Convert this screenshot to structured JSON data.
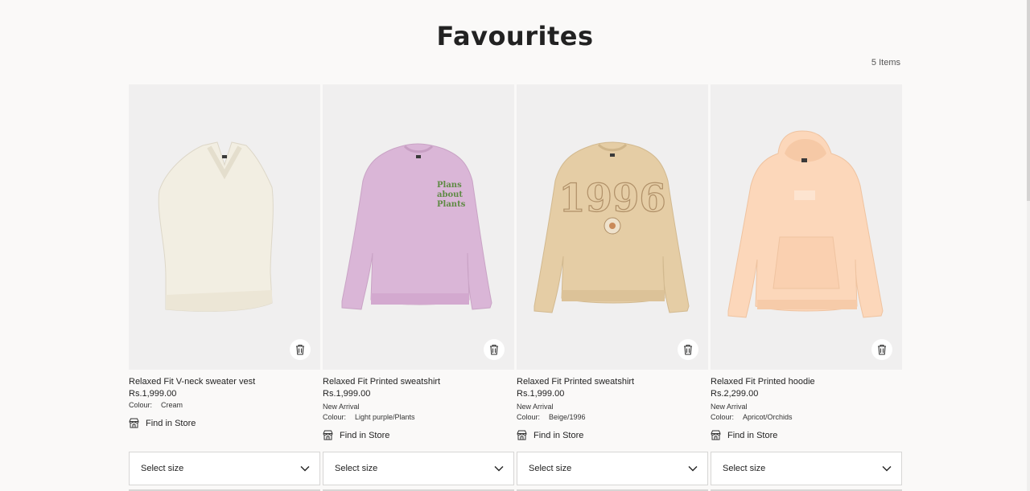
{
  "header": {
    "title": "Favourites",
    "item_count": "5 Items"
  },
  "products": [
    {
      "title": "Relaxed Fit V-neck sweater vest",
      "price": "Rs.1,999.00",
      "new_arrival": "",
      "colour_label": "Colour:",
      "colour": "Cream",
      "find_in_store": "Find in Store",
      "select_size": "Select size",
      "garment_color": "#f3efe3",
      "image_bg": "#efefef"
    },
    {
      "title": "Relaxed Fit Printed sweatshirt",
      "price": "Rs.1,999.00",
      "new_arrival": "New Arrival",
      "colour_label": "Colour:",
      "colour": "Light purple/Plants",
      "find_in_store": "Find in Store",
      "select_size": "Select size",
      "garment_color": "#dcb8d8",
      "image_bg": "#efeff0"
    },
    {
      "title": "Relaxed Fit Printed sweatshirt",
      "price": "Rs.1,999.00",
      "new_arrival": "New Arrival",
      "colour_label": "Colour:",
      "colour": "Beige/1996",
      "find_in_store": "Find in Store",
      "select_size": "Select size",
      "garment_color": "#e6cfa7",
      "image_bg": "#efeff0"
    },
    {
      "title": "Relaxed Fit Printed hoodie",
      "price": "Rs.2,299.00",
      "new_arrival": "New Arrival",
      "colour_label": "Colour:",
      "colour": "Apricot/Orchids",
      "find_in_store": "Find in Store",
      "select_size": "Select size",
      "garment_color": "#fcd9bd",
      "image_bg": "#f1f1f1"
    }
  ],
  "prints": {
    "plants": [
      "Plans",
      "about",
      "Plants"
    ],
    "year": "1996"
  },
  "icons": {
    "delete": "trash-icon",
    "store": "store-icon",
    "dropdown": "chevron-down-icon"
  }
}
